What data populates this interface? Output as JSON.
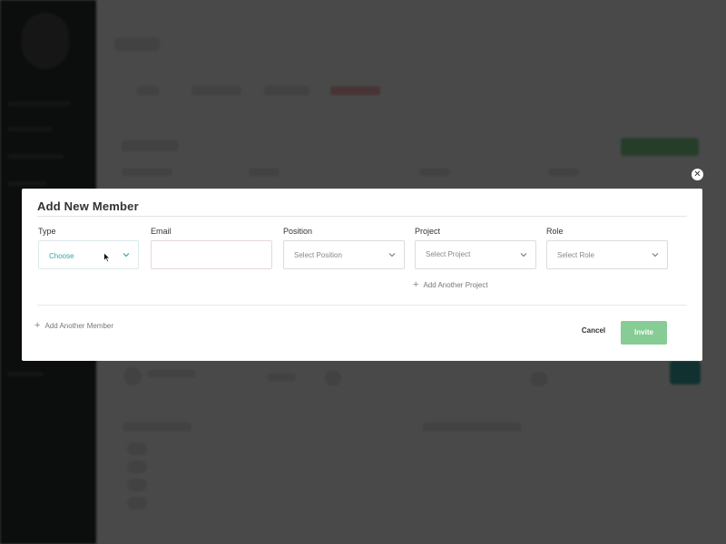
{
  "modal": {
    "title": "Add New Member",
    "close_glyph": "✕",
    "fields": {
      "type": {
        "label": "Type",
        "value": "Choose"
      },
      "email": {
        "label": "Email",
        "value": "",
        "placeholder": ""
      },
      "position": {
        "label": "Position",
        "placeholder": "Select Position"
      },
      "project": {
        "label": "Project",
        "placeholder": "Select Project"
      },
      "role": {
        "label": "Role",
        "placeholder": "Select Role"
      }
    },
    "add_project_label": "Add Another Project",
    "add_member_label": "Add Another Member",
    "plus_glyph": "+",
    "cancel_label": "Cancel",
    "invite_label": "Invite"
  },
  "icons": {
    "close": "close-icon",
    "chevron": "chevron-down-icon",
    "plus": "plus-icon",
    "cursor": "mouse-cursor-icon"
  },
  "colors": {
    "accent_teal": "#3aa3a6",
    "invite_green": "#86cc94",
    "overlay": "rgba(0,0,0,0.70)"
  }
}
